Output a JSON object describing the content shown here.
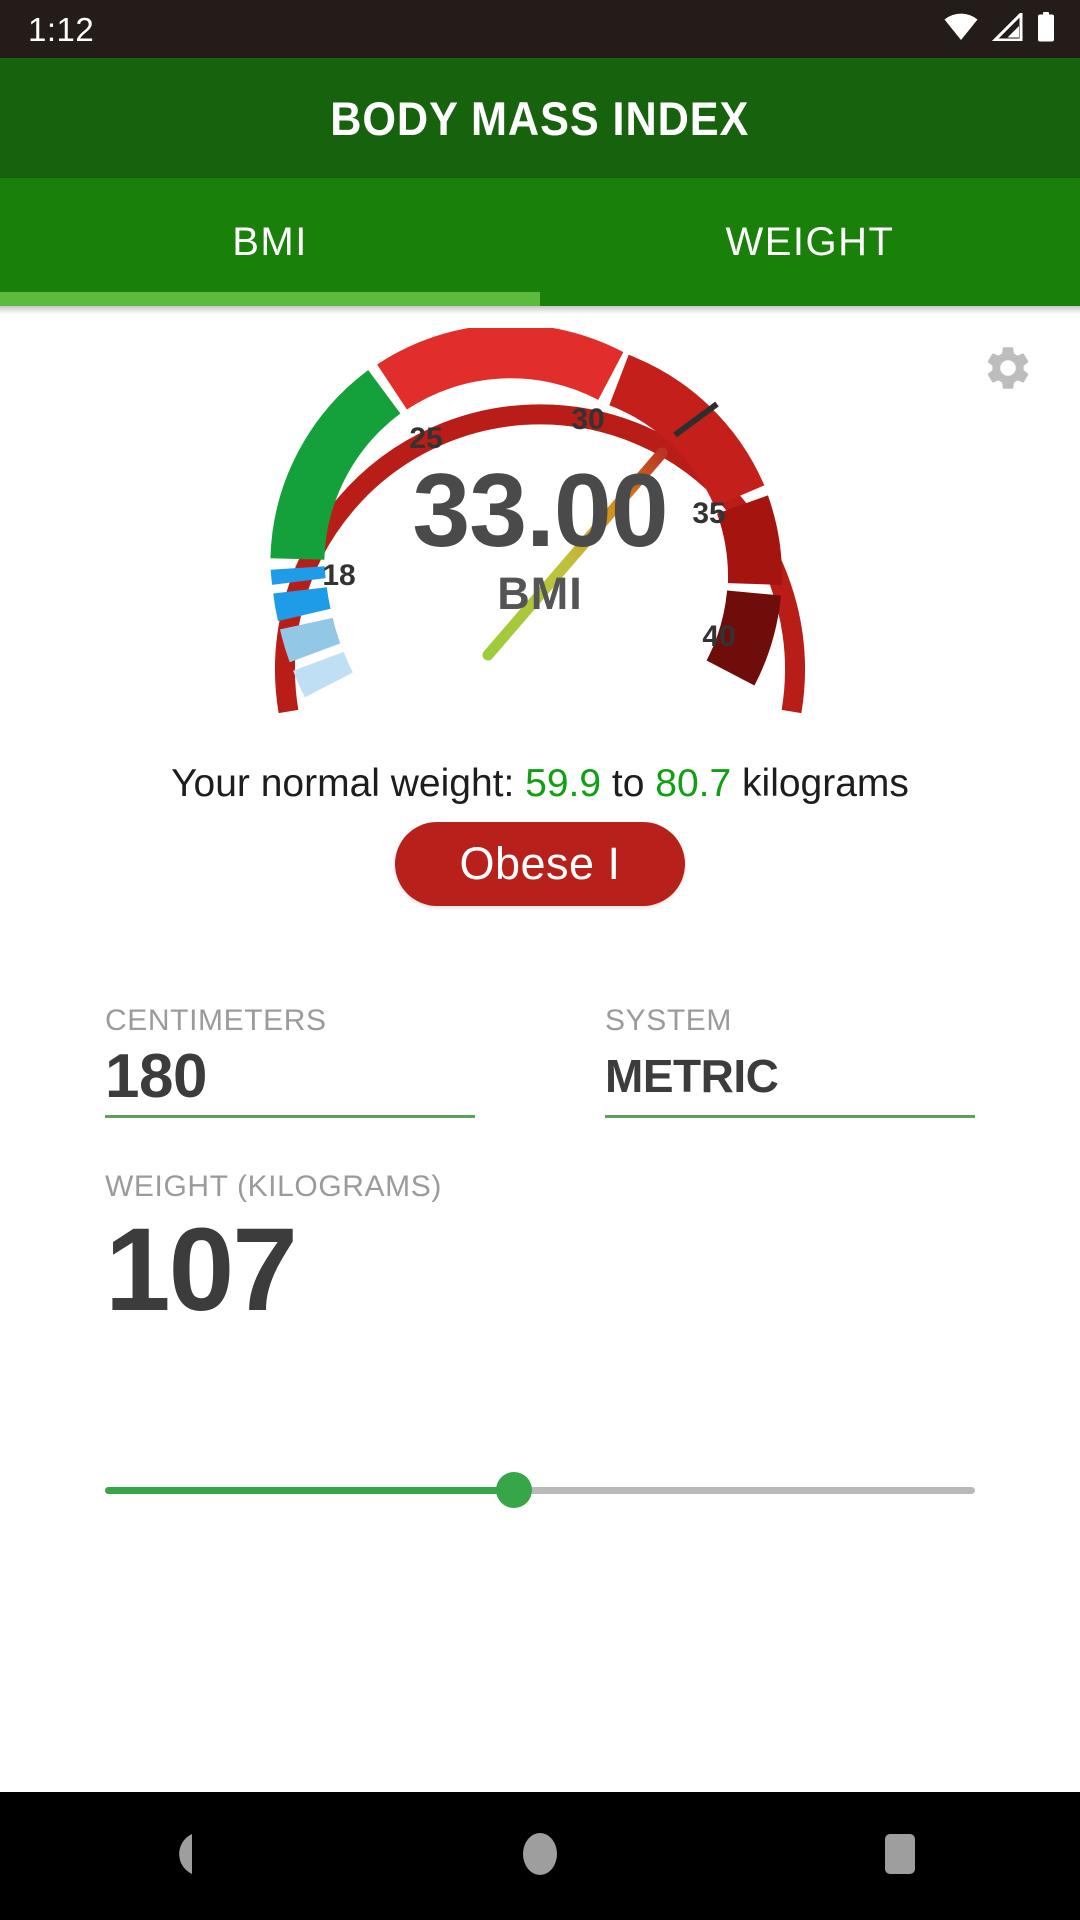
{
  "status_bar": {
    "clock": "1:12",
    "icons": [
      "wifi-icon",
      "cell-signal-icon",
      "battery-icon"
    ]
  },
  "app_bar": {
    "title": "BODY MASS INDEX",
    "background": "#17630d"
  },
  "tabs": {
    "items": [
      {
        "label": "BMI",
        "selected": true
      },
      {
        "label": "WEIGHT",
        "selected": false
      }
    ],
    "indicator_color": "#5cba3e",
    "background": "#198009"
  },
  "settings": {
    "icon": "gear-icon",
    "color": "#bdbdbd"
  },
  "gauge": {
    "value_text": "33.00",
    "unit_label": "BMI",
    "tick_labels": [
      "18",
      "25",
      "30",
      "35",
      "40"
    ],
    "needle_value": 33.0,
    "min": 10,
    "max": 45,
    "outer_ring_color": "#b81d17",
    "segments": [
      {
        "name": "severe-thinness",
        "from": 10.0,
        "to": 14.0,
        "color": "#bfe0f4"
      },
      {
        "name": "moderate-thinness",
        "from": 14.0,
        "to": 16.0,
        "color": "#93c7e6"
      },
      {
        "name": "mild-thinness",
        "from": 16.0,
        "to": 17.4,
        "color": "#1e9ce8"
      },
      {
        "name": "underweight",
        "from": 17.4,
        "to": 18.5,
        "color": "#1e9ce8"
      },
      {
        "name": "normal",
        "from": 18.5,
        "to": 25.0,
        "color": "#14a03a"
      },
      {
        "name": "overweight",
        "from": 25.0,
        "to": 30.0,
        "color": "#e22e2a"
      },
      {
        "name": "obese-1",
        "from": 30.0,
        "to": 35.0,
        "color": "#c41f1a"
      },
      {
        "name": "obese-2",
        "from": 35.0,
        "to": 40.0,
        "color": "#a5140f"
      },
      {
        "name": "obese-3",
        "from": 40.0,
        "to": 45.0,
        "color": "#6e0d0a"
      }
    ],
    "needle_gradient": [
      "#9ccc3a",
      "#d4a017",
      "#c0392b"
    ]
  },
  "normal_weight": {
    "prefix": "Your normal weight: ",
    "min": "59.9",
    "mid": " to ",
    "max": "80.7",
    "suffix": " kilograms",
    "number_color": "#11a013"
  },
  "category": {
    "label": "Obese I",
    "background": "#b8211b",
    "text_color": "#ffffff"
  },
  "inputs": {
    "height": {
      "label": "CENTIMETERS",
      "value": "180"
    },
    "system": {
      "label": "SYSTEM",
      "value": "METRIC"
    },
    "weight": {
      "label": "WEIGHT (KILOGRAMS)",
      "value": "107"
    },
    "underline_color": "#59a45a"
  },
  "slider": {
    "fill_percent": 47,
    "fill_color": "#37a648",
    "track_color": "#b9b9b9",
    "thumb_color": "#37a648"
  },
  "nav_bar": {
    "items": [
      "back-icon",
      "home-icon",
      "recents-icon"
    ],
    "color": "#9e9e9e",
    "background": "#000000"
  }
}
